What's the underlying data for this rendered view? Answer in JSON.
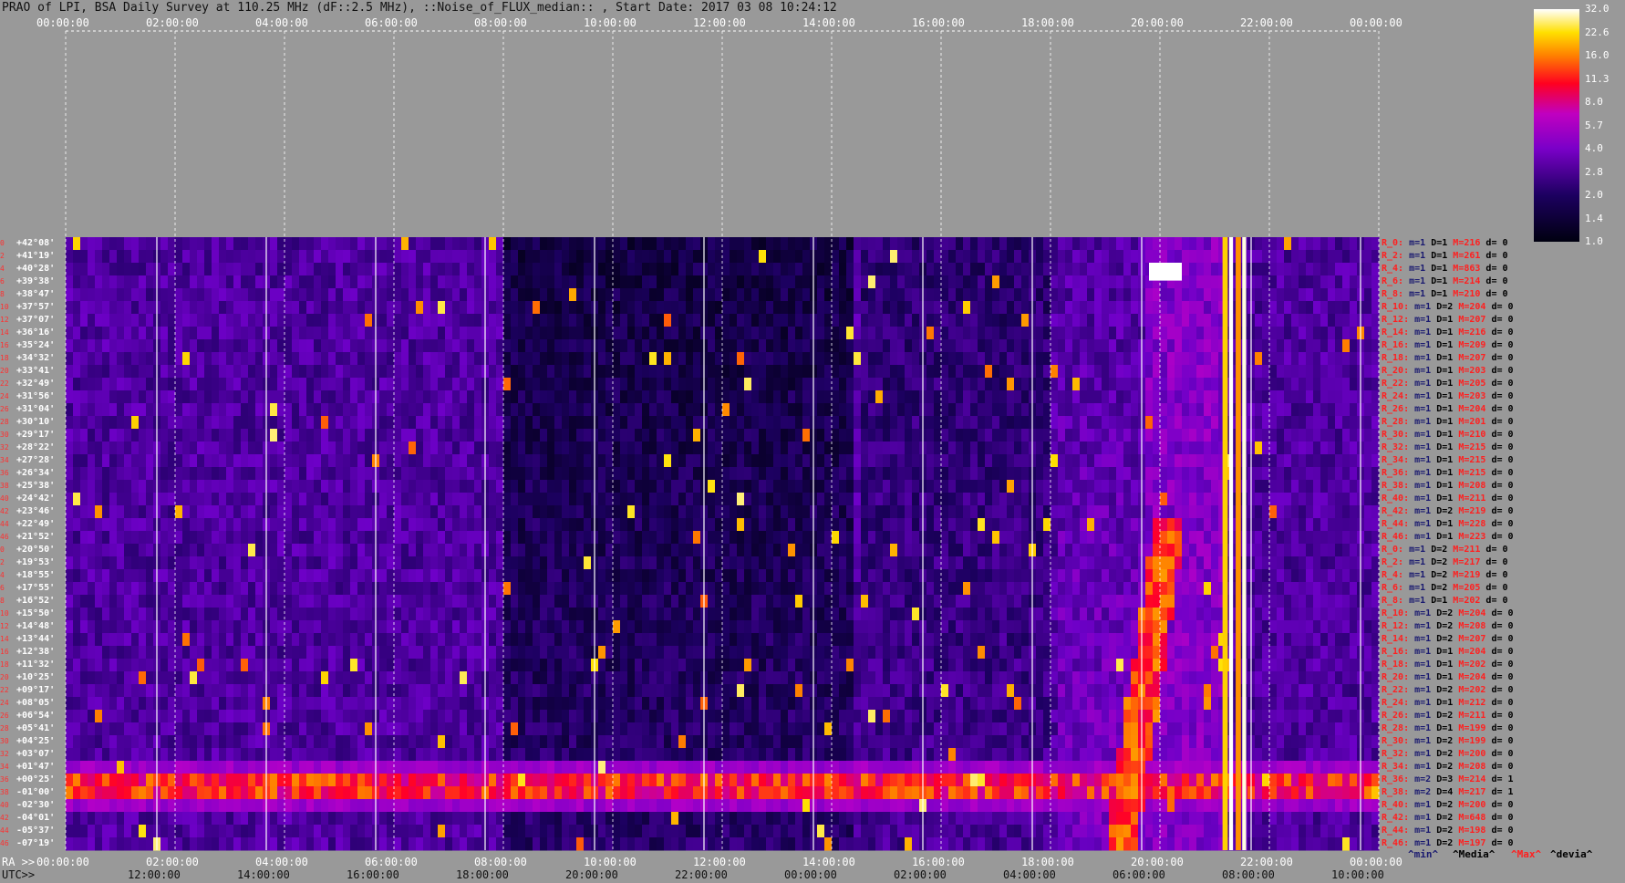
{
  "title": "PRAO of LPI, BSA Daily Survey at 110.25 MHz (dF::2.5 MHz), ::Noise_of_FLUX_median:: , Start Date: 2017 03 08 10:24:12",
  "top_ticks": [
    "00:00:00",
    "02:00:00",
    "04:00:00",
    "06:00:00",
    "08:00:00",
    "10:00:00",
    "12:00:00",
    "14:00:00",
    "16:00:00",
    "18:00:00",
    "20:00:00",
    "22:00:00",
    "00:00:00"
  ],
  "ra_prefix": "RA >>",
  "utc_prefix": "UTC>>",
  "ra_ticks": [
    "00:00:00",
    "02:00:00",
    "04:00:00",
    "06:00:00",
    "08:00:00",
    "10:00:00",
    "12:00:00",
    "14:00:00",
    "16:00:00",
    "18:00:00",
    "20:00:00",
    "22:00:00",
    "00:00:00"
  ],
  "utc_ticks": [
    "12:00:00",
    "14:00:00",
    "16:00:00",
    "18:00:00",
    "20:00:00",
    "22:00:00",
    "00:00:00",
    "02:00:00",
    "04:00:00",
    "06:00:00",
    "08:00:00",
    "10:00:00"
  ],
  "declinations": [
    "+42°08'",
    "+41°19'",
    "+40°28'",
    "+39°38'",
    "+38°47'",
    "+37°57'",
    "+37°07'",
    "+36°16'",
    "+35°24'",
    "+34°32'",
    "+33°41'",
    "+32°49'",
    "+31°56'",
    "+31°04'",
    "+30°10'",
    "+29°17'",
    "+28°22'",
    "+27°28'",
    "+26°34'",
    "+25°38'",
    "+24°42'",
    "+23°46'",
    "+22°49'",
    "+21°52'",
    "+20°50'",
    "+19°53'",
    "+18°55'",
    "+17°55'",
    "+16°52'",
    "+15°50'",
    "+14°48'",
    "+13°44'",
    "+12°38'",
    "+11°32'",
    "+10°25'",
    "+09°17'",
    "+08°05'",
    "+06°54'",
    "+05°41'",
    "+04°25'",
    "+03°07'",
    "+01°47'",
    "+00°25'",
    "-01°00'",
    "-02°30'",
    "-04°01'",
    "-05°37'",
    "-07°19'"
  ],
  "row_numbers": [
    "0",
    "2",
    "4",
    "6",
    "8",
    "10",
    "12",
    "14",
    "16",
    "18",
    "20",
    "22",
    "24",
    "26",
    "28",
    "30",
    "32",
    "34",
    "36",
    "38",
    "40",
    "42",
    "44",
    "46",
    "0",
    "2",
    "4",
    "6",
    "8",
    "10",
    "12",
    "14",
    "16",
    "18",
    "20",
    "22",
    "24",
    "26",
    "28",
    "30",
    "32",
    "34",
    "36",
    "38",
    "40",
    "42",
    "44",
    "46"
  ],
  "stats": [
    {
      "r": "R_0:",
      "m": "m=1",
      "d": "D=1",
      "M": "M=216",
      "dev": "d= 0"
    },
    {
      "r": "R_2:",
      "m": "m=1",
      "d": "D=1",
      "M": "M=261",
      "dev": "d= 0"
    },
    {
      "r": "R_4:",
      "m": "m=1",
      "d": "D=1",
      "M": "M=863",
      "dev": "d= 0"
    },
    {
      "r": "R_6:",
      "m": "m=1",
      "d": "D=1",
      "M": "M=214",
      "dev": "d= 0"
    },
    {
      "r": "R_8:",
      "m": "m=1",
      "d": "D=1",
      "M": "M=210",
      "dev": "d= 0"
    },
    {
      "r": "R_10:",
      "m": "m=1",
      "d": "D=2",
      "M": "M=204",
      "dev": "d= 0"
    },
    {
      "r": "R_12:",
      "m": "m=1",
      "d": "D=1",
      "M": "M=207",
      "dev": "d= 0"
    },
    {
      "r": "R_14:",
      "m": "m=1",
      "d": "D=1",
      "M": "M=216",
      "dev": "d= 0"
    },
    {
      "r": "R_16:",
      "m": "m=1",
      "d": "D=1",
      "M": "M=209",
      "dev": "d= 0"
    },
    {
      "r": "R_18:",
      "m": "m=1",
      "d": "D=1",
      "M": "M=207",
      "dev": "d= 0"
    },
    {
      "r": "R_20:",
      "m": "m=1",
      "d": "D=1",
      "M": "M=203",
      "dev": "d= 0"
    },
    {
      "r": "R_22:",
      "m": "m=1",
      "d": "D=1",
      "M": "M=205",
      "dev": "d= 0"
    },
    {
      "r": "R_24:",
      "m": "m=1",
      "d": "D=1",
      "M": "M=203",
      "dev": "d= 0"
    },
    {
      "r": "R_26:",
      "m": "m=1",
      "d": "D=1",
      "M": "M=204",
      "dev": "d= 0"
    },
    {
      "r": "R_28:",
      "m": "m=1",
      "d": "D=1",
      "M": "M=201",
      "dev": "d= 0"
    },
    {
      "r": "R_30:",
      "m": "m=1",
      "d": "D=1",
      "M": "M=210",
      "dev": "d= 0"
    },
    {
      "r": "R_32:",
      "m": "m=1",
      "d": "D=1",
      "M": "M=215",
      "dev": "d= 0"
    },
    {
      "r": "R_34:",
      "m": "m=1",
      "d": "D=1",
      "M": "M=215",
      "dev": "d= 0"
    },
    {
      "r": "R_36:",
      "m": "m=1",
      "d": "D=1",
      "M": "M=215",
      "dev": "d= 0"
    },
    {
      "r": "R_38:",
      "m": "m=1",
      "d": "D=1",
      "M": "M=208",
      "dev": "d= 0"
    },
    {
      "r": "R_40:",
      "m": "m=1",
      "d": "D=1",
      "M": "M=211",
      "dev": "d= 0"
    },
    {
      "r": "R_42:",
      "m": "m=1",
      "d": "D=2",
      "M": "M=219",
      "dev": "d= 0"
    },
    {
      "r": "R_44:",
      "m": "m=1",
      "d": "D=1",
      "M": "M=228",
      "dev": "d= 0"
    },
    {
      "r": "R_46:",
      "m": "m=1",
      "d": "D=1",
      "M": "M=223",
      "dev": "d= 0"
    },
    {
      "r": "R_0:",
      "m": "m=1",
      "d": "D=2",
      "M": "M=211",
      "dev": "d= 0"
    },
    {
      "r": "R_2:",
      "m": "m=1",
      "d": "D=2",
      "M": "M=217",
      "dev": "d= 0"
    },
    {
      "r": "R_4:",
      "m": "m=1",
      "d": "D=2",
      "M": "M=219",
      "dev": "d= 0"
    },
    {
      "r": "R_6:",
      "m": "m=1",
      "d": "D=2",
      "M": "M=205",
      "dev": "d= 0"
    },
    {
      "r": "R_8:",
      "m": "m=1",
      "d": "D=1",
      "M": "M=202",
      "dev": "d= 0"
    },
    {
      "r": "R_10:",
      "m": "m=1",
      "d": "D=2",
      "M": "M=204",
      "dev": "d= 0"
    },
    {
      "r": "R_12:",
      "m": "m=1",
      "d": "D=2",
      "M": "M=208",
      "dev": "d= 0"
    },
    {
      "r": "R_14:",
      "m": "m=1",
      "d": "D=2",
      "M": "M=207",
      "dev": "d= 0"
    },
    {
      "r": "R_16:",
      "m": "m=1",
      "d": "D=1",
      "M": "M=204",
      "dev": "d= 0"
    },
    {
      "r": "R_18:",
      "m": "m=1",
      "d": "D=1",
      "M": "M=202",
      "dev": "d= 0"
    },
    {
      "r": "R_20:",
      "m": "m=1",
      "d": "D=1",
      "M": "M=204",
      "dev": "d= 0"
    },
    {
      "r": "R_22:",
      "m": "m=1",
      "d": "D=2",
      "M": "M=202",
      "dev": "d= 0"
    },
    {
      "r": "R_24:",
      "m": "m=1",
      "d": "D=1",
      "M": "M=212",
      "dev": "d= 0"
    },
    {
      "r": "R_26:",
      "m": "m=1",
      "d": "D=2",
      "M": "M=211",
      "dev": "d= 0"
    },
    {
      "r": "R_28:",
      "m": "m=1",
      "d": "D=1",
      "M": "M=199",
      "dev": "d= 0"
    },
    {
      "r": "R_30:",
      "m": "m=1",
      "d": "D=2",
      "M": "M=199",
      "dev": "d= 0"
    },
    {
      "r": "R_32:",
      "m": "m=1",
      "d": "D=2",
      "M": "M=200",
      "dev": "d= 0"
    },
    {
      "r": "R_34:",
      "m": "m=1",
      "d": "D=2",
      "M": "M=208",
      "dev": "d= 0"
    },
    {
      "r": "R_36:",
      "m": "m=2",
      "d": "D=3",
      "M": "M=214",
      "dev": "d= 1"
    },
    {
      "r": "R_38:",
      "m": "m=2",
      "d": "D=4",
      "M": "M=217",
      "dev": "d= 1"
    },
    {
      "r": "R_40:",
      "m": "m=1",
      "d": "D=2",
      "M": "M=200",
      "dev": "d= 0"
    },
    {
      "r": "R_42:",
      "m": "m=1",
      "d": "D=2",
      "M": "M=648",
      "dev": "d= 0"
    },
    {
      "r": "R_44:",
      "m": "m=1",
      "d": "D=2",
      "M": "M=198",
      "dev": "d= 0"
    },
    {
      "r": "R_46:",
      "m": "m=1",
      "d": "D=2",
      "M": "M=197",
      "dev": "d= 0"
    }
  ],
  "colorbar_labels": [
    "32.0",
    "22.6",
    "16.0",
    "11.3",
    "8.0",
    "5.7",
    "4.0",
    "2.8",
    "2.0",
    "1.4",
    "1.0"
  ],
  "legend": {
    "min": "^min^",
    "media": "^Media^",
    "max": "^Max^",
    "devia": "^devia^"
  },
  "colors": {
    "min": "#1a1a70",
    "media": "#000000",
    "max": "#ff2020",
    "devia": "#000000"
  },
  "chart_data": {
    "type": "heatmap",
    "title": "PRAO of LPI, BSA Daily Survey at 110.25 MHz (dF::2.5 MHz), ::Noise_of_FLUX_median:: , Start Date: 2017 03 08 10:24:12",
    "x_range": [
      "00:00:00",
      "24:00:00"
    ],
    "y_rows": 48,
    "colorbar_range": [
      1.0,
      32.0
    ],
    "colormap": [
      "black",
      "navy",
      "purple",
      "red",
      "orange",
      "yellow",
      "white"
    ],
    "notable_features": [
      {
        "ra_hours": [
          0,
          24
        ],
        "dec": "-01°00'",
        "intensity": 8.0
      },
      {
        "ra_hours": [
          19.0,
          20.0
        ],
        "dec": [
          "+42°08'",
          "-07°19'"
        ],
        "intensity": 11.3
      },
      {
        "ra_hours": [
          21.3,
          21.6
        ],
        "dec": [
          "+42°08'",
          "-07°19'"
        ],
        "intensity": 32.0
      },
      {
        "ra_hours": [
          19.9,
          20.1
        ],
        "dec": "+40°28'",
        "intensity": 32.0
      }
    ]
  }
}
